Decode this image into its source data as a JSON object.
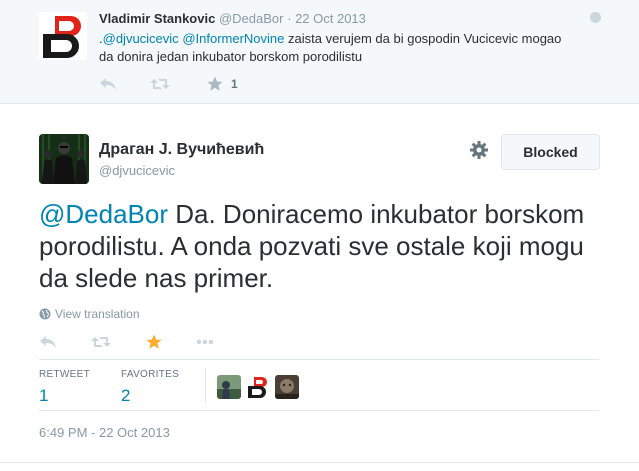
{
  "parent_tweet": {
    "name": "Vladimir Stankovic",
    "handle": "@DedaBor",
    "separator": "·",
    "time": "22 Oct 2013",
    "text_prefix": ".",
    "mention1": "@djvucicevic",
    "mention2": "@InformerNovine",
    "text_body": " zaista verujem da bi gospodin Vucicevic mogao da donira jedan inkubator borskom porodilistu",
    "favorite_count": "1"
  },
  "main_tweet": {
    "name": "Драган J. Вучићевић",
    "handle": "@djvucicevic",
    "blocked_label": "Blocked",
    "mention": "@DedaBor",
    "text": "  Da. Doniracemo inkubator borskom porodilistu. A onda pozvati sve ostale koji mogu da slede nas primer.",
    "view_translation": "View translation",
    "stats": {
      "retweets_label": "RETWEET",
      "retweets_value": "1",
      "favorites_label": "FAVORITES",
      "favorites_value": "2"
    },
    "timestamp": "6:49 PM - 22 Oct 2013"
  },
  "colors": {
    "link": "#0084b4",
    "favorite_star": "#ffac33",
    "icon_gray": "#ccd6dd",
    "background_parent": "#f5f8fa"
  },
  "icons": [
    "reply-icon",
    "retweet-icon",
    "star-icon",
    "more-icon",
    "gear-icon",
    "globe-icon"
  ]
}
